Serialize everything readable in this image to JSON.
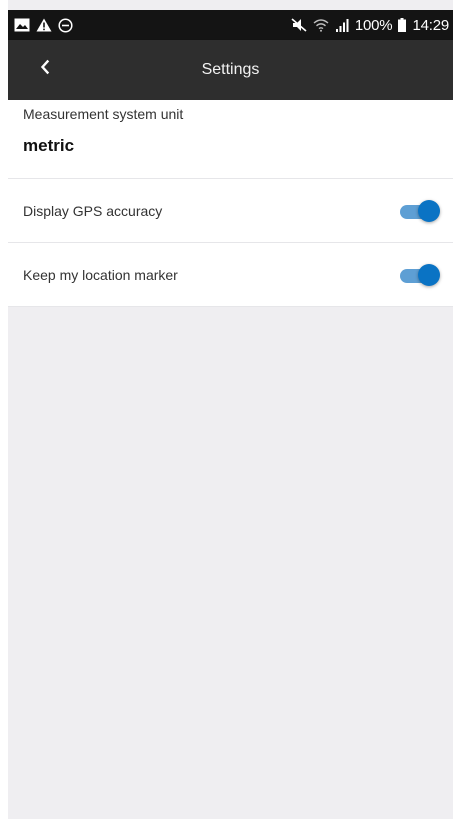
{
  "status_bar": {
    "battery_percent": "100%",
    "clock": "14:29",
    "icons_left": [
      "gallery-icon",
      "warning-icon",
      "do-not-disturb-icon"
    ],
    "icons_right": [
      "mute-icon",
      "wifi-icon",
      "signal-icon",
      "battery-icon"
    ]
  },
  "app_bar": {
    "title": "Settings",
    "back_icon": "chevron-left-icon"
  },
  "settings": {
    "measurement": {
      "label": "Measurement system unit",
      "value": "metric"
    },
    "gps_accuracy": {
      "label": "Display GPS accuracy",
      "enabled": true
    },
    "keep_marker": {
      "label": "Keep my location marker",
      "enabled": true
    }
  },
  "colors": {
    "status_bar": "#141414",
    "app_bar": "#2e2e2e",
    "toggle_thumb": "#0a73c4",
    "toggle_track": "#5e9fd4",
    "background": "#efeef1"
  }
}
